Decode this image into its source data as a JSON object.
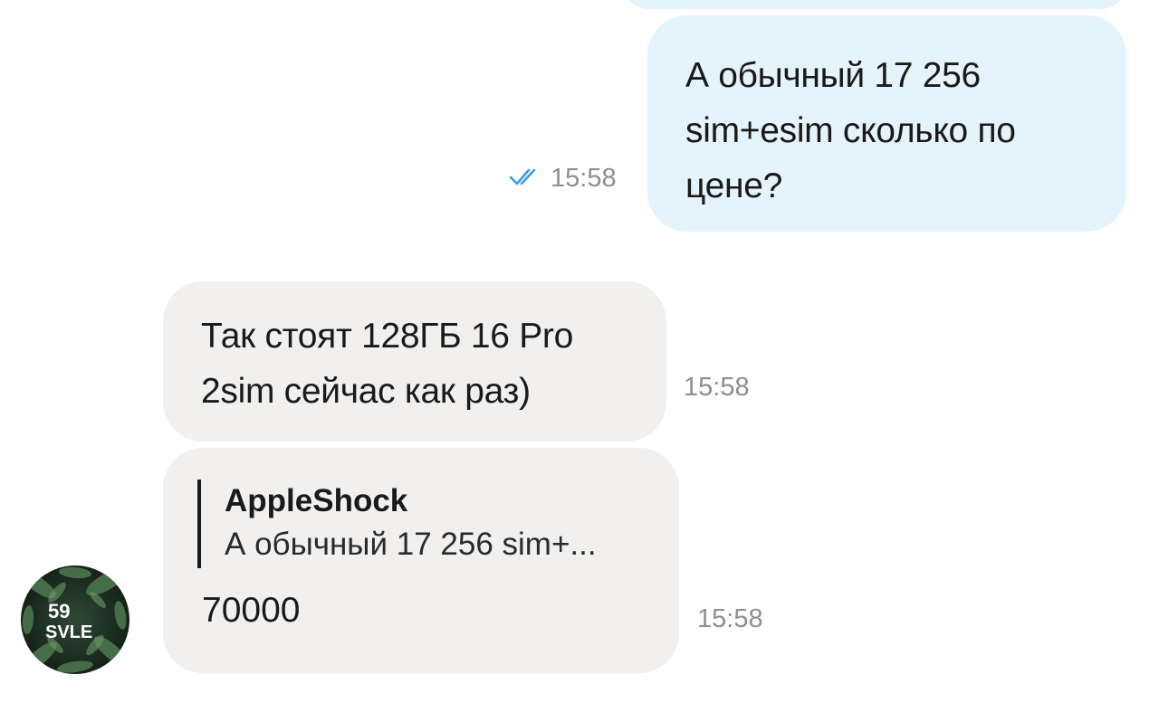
{
  "colors": {
    "outgoing_bubble": "#e5f3fc",
    "incoming_bubble": "#f1f0ef",
    "read_check": "#3a9be0",
    "timestamp": "#8e8e93"
  },
  "messages": [
    {
      "direction": "outgoing",
      "text": "А обычный 17 256\nsim+esim сколько по\nцене?",
      "time": "15:58",
      "status_icon": "double-check-icon"
    },
    {
      "direction": "incoming",
      "text": "Так стоят 128ГБ 16 Pro\n2sim сейчас как раз)",
      "time": "15:58"
    },
    {
      "direction": "incoming",
      "reply_to": {
        "author": "AppleShock",
        "text": "А обычный 17 256 sim+..."
      },
      "text": "70000",
      "time": "15:58"
    }
  ],
  "sender": {
    "avatar_text_line1": "59",
    "avatar_text_line2": "SVLE",
    "avatar_icon": "leaf-pattern-avatar"
  }
}
